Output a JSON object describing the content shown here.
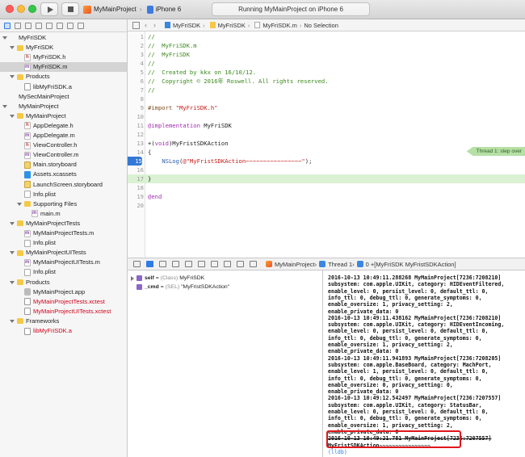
{
  "window": {
    "scheme": "MyMainProject",
    "device": "iPhone 6",
    "status": "Running MyMainProject on iPhone 6"
  },
  "icons": {
    "run": "play-icon",
    "stop": "stop-icon",
    "breakpoint": "breakpoint-icon"
  },
  "navigator": {
    "items": [
      {
        "label": "MyFriSDK",
        "icon": "project",
        "indent": 0,
        "disclosure": true
      },
      {
        "label": "MyFriSDK",
        "icon": "folder",
        "indent": 1,
        "disclosure": true
      },
      {
        "label": "MyFriSDK.h",
        "icon": "h",
        "indent": 2,
        "disclosure": false
      },
      {
        "label": "MyFriSDK.m",
        "icon": "m",
        "indent": 2,
        "disclosure": false,
        "selected": true
      },
      {
        "label": "Products",
        "icon": "folder",
        "indent": 1,
        "disclosure": true
      },
      {
        "label": "libMyFriSDK.a",
        "icon": "lib",
        "indent": 2,
        "disclosure": false
      },
      {
        "label": "MySecMainProject",
        "icon": "project",
        "indent": 0,
        "disclosure": false
      },
      {
        "label": "MyMainProject",
        "icon": "project",
        "indent": 0,
        "disclosure": true
      },
      {
        "label": "MyMainProject",
        "icon": "folder",
        "indent": 1,
        "disclosure": true
      },
      {
        "label": "AppDelegate.h",
        "icon": "h",
        "indent": 2,
        "disclosure": false
      },
      {
        "label": "AppDelegate.m",
        "icon": "m",
        "indent": 2,
        "disclosure": false
      },
      {
        "label": "ViewController.h",
        "icon": "h",
        "indent": 2,
        "disclosure": false
      },
      {
        "label": "ViewController.m",
        "icon": "m",
        "indent": 2,
        "disclosure": false
      },
      {
        "label": "Main.storyboard",
        "icon": "sb",
        "indent": 2,
        "disclosure": false
      },
      {
        "label": "Assets.xcassets",
        "icon": "assets",
        "indent": 2,
        "disclosure": false
      },
      {
        "label": "LaunchScreen.storyboard",
        "icon": "sb",
        "indent": 2,
        "disclosure": false
      },
      {
        "label": "Info.plist",
        "icon": "plist",
        "indent": 2,
        "disclosure": false
      },
      {
        "label": "Supporting Files",
        "icon": "folder",
        "indent": 2,
        "disclosure": true
      },
      {
        "label": "main.m",
        "icon": "m",
        "indent": 3,
        "disclosure": false
      },
      {
        "label": "MyMainProjectTests",
        "icon": "folder",
        "indent": 1,
        "disclosure": true
      },
      {
        "label": "MyMainProjectTests.m",
        "icon": "m",
        "indent": 2,
        "disclosure": false
      },
      {
        "label": "Info.plist",
        "icon": "plist",
        "indent": 2,
        "disclosure": false
      },
      {
        "label": "MyMainProjectUITests",
        "icon": "folder",
        "indent": 1,
        "disclosure": true
      },
      {
        "label": "MyMainProjectUITests.m",
        "icon": "m",
        "indent": 2,
        "disclosure": false
      },
      {
        "label": "Info.plist",
        "icon": "plist",
        "indent": 2,
        "disclosure": false
      },
      {
        "label": "Products",
        "icon": "folder",
        "indent": 1,
        "disclosure": true
      },
      {
        "label": "MyMainProject.app",
        "icon": "app",
        "indent": 2,
        "disclosure": false
      },
      {
        "label": "MyMainProjectTests.xctest",
        "icon": "lib",
        "indent": 2,
        "disclosure": false,
        "red": true
      },
      {
        "label": "MyMainProjectUITests.xctest",
        "icon": "lib",
        "indent": 2,
        "disclosure": false,
        "red": true
      },
      {
        "label": "Frameworks",
        "icon": "folder",
        "indent": 1,
        "disclosure": true
      },
      {
        "label": "libMyFriSDK.a",
        "icon": "lib",
        "indent": 2,
        "disclosure": false,
        "red": true
      }
    ]
  },
  "jumpbar": {
    "crumbs": [
      "MyFriSDK",
      "MyFriSDK",
      "MyFriSDK.m",
      "No Selection"
    ]
  },
  "editor": {
    "lines": [
      {
        "n": "1",
        "segs": [
          {
            "t": "//",
            "c": "comment"
          }
        ]
      },
      {
        "n": "2",
        "segs": [
          {
            "t": "//  MyFriSDK.m",
            "c": "comment"
          }
        ]
      },
      {
        "n": "3",
        "segs": [
          {
            "t": "//  MyFriSDK",
            "c": "comment"
          }
        ]
      },
      {
        "n": "4",
        "segs": [
          {
            "t": "//",
            "c": "comment"
          }
        ]
      },
      {
        "n": "5",
        "segs": [
          {
            "t": "//  Created by kkx on 16/10/12.",
            "c": "comment"
          }
        ]
      },
      {
        "n": "6",
        "segs": [
          {
            "t": "//  Copyright © 2016年 Roswell. All rights reserved.",
            "c": "comment"
          }
        ]
      },
      {
        "n": "7",
        "segs": [
          {
            "t": "//",
            "c": "comment"
          }
        ]
      },
      {
        "n": "8",
        "segs": []
      },
      {
        "n": "9",
        "segs": [
          {
            "t": "#import ",
            "c": "pre"
          },
          {
            "t": "\"MyFriSDK.h\"",
            "c": "str"
          }
        ]
      },
      {
        "n": "10",
        "segs": []
      },
      {
        "n": "11",
        "segs": [
          {
            "t": "@implementation",
            "c": "kw"
          },
          {
            "t": " MyFriSDK",
            "c": "plain"
          }
        ]
      },
      {
        "n": "12",
        "segs": []
      },
      {
        "n": "13",
        "segs": [
          {
            "t": "+(",
            "c": "plain"
          },
          {
            "t": "void",
            "c": "kw"
          },
          {
            "t": ")MyFristSDKAction",
            "c": "plain"
          }
        ]
      },
      {
        "n": "14",
        "segs": [
          {
            "t": "{",
            "c": "plain"
          }
        ]
      },
      {
        "n": "15",
        "bp": true,
        "segs": [
          {
            "t": "    ",
            "c": "plain"
          },
          {
            "t": "NSLog",
            "c": "fn"
          },
          {
            "t": "(",
            "c": "plain"
          },
          {
            "t": "@\"MyFristSDKAction~~~~~~~~~~~~~~~~\"",
            "c": "str"
          },
          {
            "t": ");",
            "c": "plain"
          }
        ]
      },
      {
        "n": "16",
        "segs": []
      },
      {
        "n": "17",
        "current": true,
        "segs": [
          {
            "t": "}",
            "c": "plain"
          }
        ]
      },
      {
        "n": "18",
        "segs": []
      },
      {
        "n": "19",
        "segs": [
          {
            "t": "@end",
            "c": "kw"
          }
        ]
      },
      {
        "n": "20",
        "segs": []
      }
    ],
    "thread_label": "Thread 1: step over"
  },
  "debugbar": {
    "crumbs": [
      "MyMainProject",
      "Thread 1",
      "0 +[MyFriSDK MyFristSDKAction]"
    ]
  },
  "variables": [
    {
      "name": "self",
      "type": "(Class)",
      "value": "MyFriSDK"
    },
    {
      "name": "_cmd",
      "type": "(SEL)",
      "value": "\"MyFristSDKAction\""
    }
  ],
  "console": {
    "lines": [
      "2016-10-13 10:49:11.288268 MyMainProject[7236:7208210]",
      "subsystem: com.apple.UIKit, category: HIDEventFiltered,",
      "enable_level: 0, persist_level: 0, default_ttl: 0,",
      "info_ttl: 0, debug_ttl: 0, generate_symptoms: 0,",
      "enable_oversize: 1, privacy_setting: 2,",
      "enable_private_data: 0",
      "2016-10-13 10:49:11.438162 MyMainProject[7236:7208210]",
      "subsystem: com.apple.UIKit, category: HIDEventIncoming,",
      "enable_level: 0, persist_level: 0, default_ttl: 0,",
      "info_ttl: 0, debug_ttl: 0, generate_symptoms: 0,",
      "enable_oversize: 1, privacy_setting: 2,",
      "enable_private_data: 0",
      "2016-10-13 10:49:11.941893 MyMainProject[7236:7208205]",
      "subsystem: com.apple.BaseBoard, category: MachPort,",
      "enable_level: 1, persist_level: 0, default_ttl: 0,",
      "info_ttl: 0, debug_ttl: 0, generate_symptoms: 0,",
      "enable_oversize: 0, privacy_setting: 0,",
      "enable_private_data: 0",
      "2016-10-13 10:49:12.542497 MyMainProject[7236:7207557]",
      "subsystem: com.apple.UIKit, category: StatusBar,",
      "enable_level: 0, persist_level: 0, default_ttl: 0,",
      "info_ttl: 0, debug_ttl: 0, generate_symptoms: 0,",
      "enable_oversize: 1, privacy_setting: 2,",
      "enable_private_data: 0"
    ],
    "highlight_lines": [
      "2016-10-13 10:49:21.781 MyMainProject[7236:7207557]",
      "MyFristSDKAction~~~~~~~~~~~~~~~~"
    ],
    "prompt": "(lldb)"
  },
  "colors": {
    "accent": "#2f7be6",
    "highlight_box": "#e0161b",
    "current_line": "#dbf1d3"
  }
}
